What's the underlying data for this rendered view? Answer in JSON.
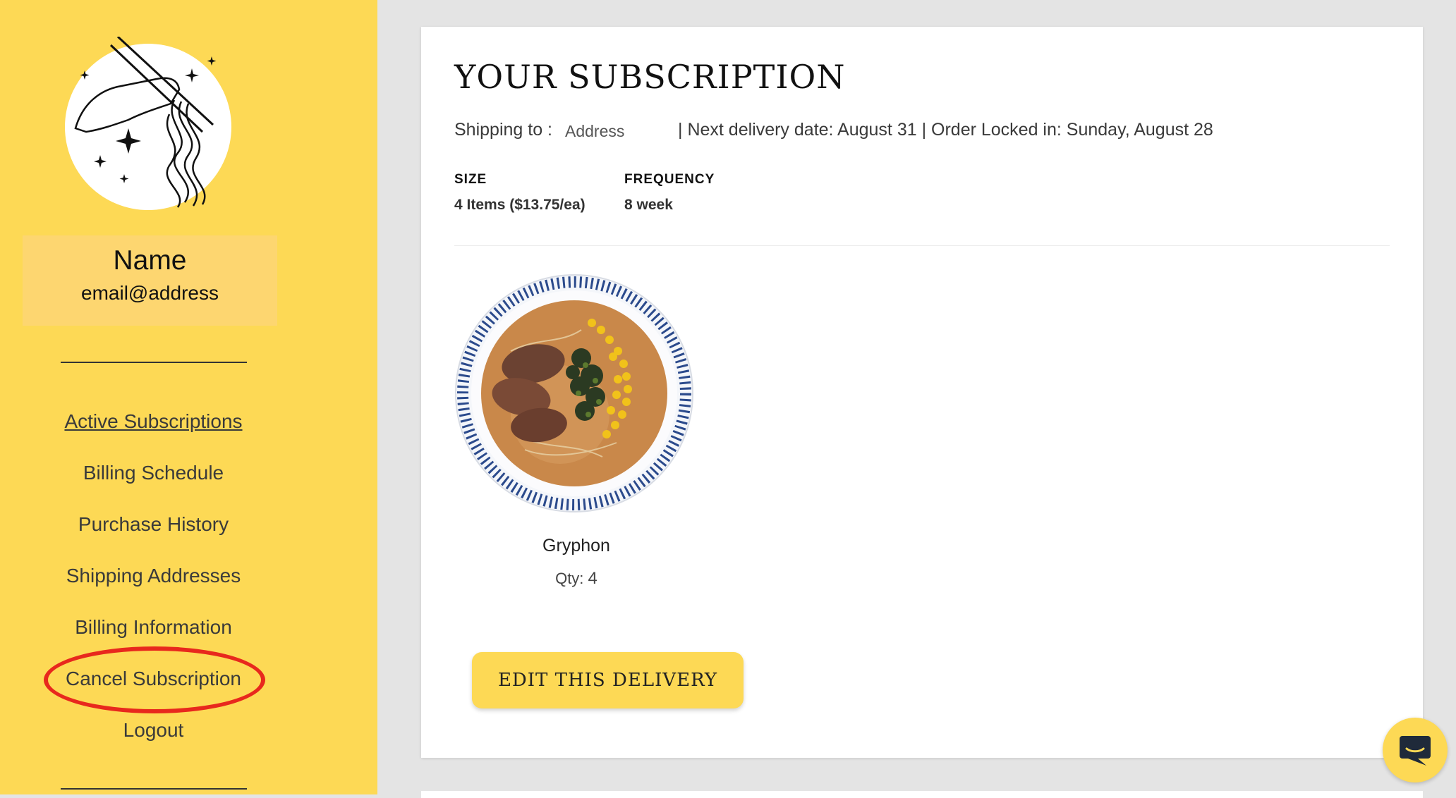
{
  "sidebar": {
    "profile": {
      "name": "Name",
      "email": "email@address"
    },
    "nav": [
      {
        "label": "Active Subscriptions",
        "active": true
      },
      {
        "label": "Billing Schedule"
      },
      {
        "label": "Purchase History"
      },
      {
        "label": "Shipping Addresses"
      },
      {
        "label": "Billing Information"
      },
      {
        "label": "Cancel Subscription",
        "highlighted": true
      },
      {
        "label": "Logout"
      }
    ]
  },
  "subscription": {
    "title": "YOUR SUBSCRIPTION",
    "shipping_label": "Shipping to :",
    "shipping_address": "Address",
    "delivery_info": "| Next delivery date: August 31 | Order Locked in: Sunday, August 28",
    "size_label": "SIZE",
    "size_value": "4 Items ($13.75/ea)",
    "frequency_label": "FREQUENCY",
    "frequency_value": "8 week",
    "product": {
      "name": "Gryphon",
      "qty_label": "Qty:",
      "qty": "4"
    },
    "edit_button": "EDIT THIS DELIVERY"
  },
  "icons": {
    "logo": "hand-chopsticks-noodles-logo",
    "chat": "chat-bubble-icon"
  },
  "colors": {
    "sidebar_bg": "#fdd955",
    "accent": "#fdd955",
    "highlight_ring": "#e8281d",
    "page_bg": "#e4e4e4"
  }
}
